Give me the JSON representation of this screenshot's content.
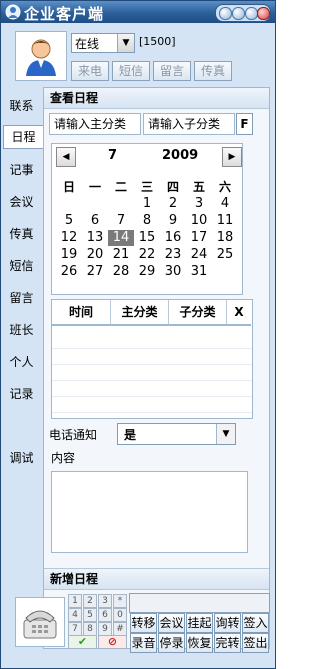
{
  "window": {
    "title": "企业客户端"
  },
  "status": {
    "value": "在线",
    "count": "[1500]"
  },
  "top_buttons": [
    "来电",
    "短信",
    "留言",
    "传真"
  ],
  "sidebar": {
    "items": [
      "联系",
      "日程",
      "记事",
      "会议",
      "传真",
      "短信",
      "留言",
      "班长",
      "个人",
      "记录",
      "调试"
    ],
    "active": "日程"
  },
  "schedule": {
    "title": "查看日程",
    "main_category_placeholder": "请输入主分类",
    "sub_category_placeholder": "请输入子分类",
    "f_button": "F",
    "calendar": {
      "month": "7",
      "year": "2009",
      "weekdays": [
        "日",
        "一",
        "二",
        "三",
        "四",
        "五",
        "六"
      ],
      "rows": [
        [
          "",
          "",
          "",
          "1",
          "2",
          "3",
          "4"
        ],
        [
          "5",
          "6",
          "7",
          "8",
          "9",
          "10",
          "11"
        ],
        [
          "12",
          "13",
          "14",
          "15",
          "16",
          "17",
          "18"
        ],
        [
          "19",
          "20",
          "21",
          "22",
          "23",
          "24",
          "25"
        ],
        [
          "26",
          "27",
          "28",
          "29",
          "30",
          "31",
          ""
        ]
      ],
      "selected": "14"
    },
    "table_headers": [
      "时间",
      "主分类",
      "子分类",
      "X"
    ],
    "notify_label": "电话通知",
    "notify_value": "是",
    "content_label": "内容",
    "new_title": "新增日程"
  },
  "keypad": [
    "1",
    "2",
    "3",
    "*",
    "4",
    "5",
    "6",
    "0",
    "7",
    "8",
    "9",
    "#"
  ],
  "actions": [
    "转移",
    "会议",
    "挂起",
    "询转",
    "签入",
    "录音",
    "停录",
    "恢复",
    "完转",
    "签出"
  ],
  "colors": {
    "title_bar": "#2c5f99",
    "panel_bg": "#d4e4f4",
    "selected_day": "#7a7a7a",
    "ok": "#2aa02a",
    "cancel": "#d02020"
  }
}
